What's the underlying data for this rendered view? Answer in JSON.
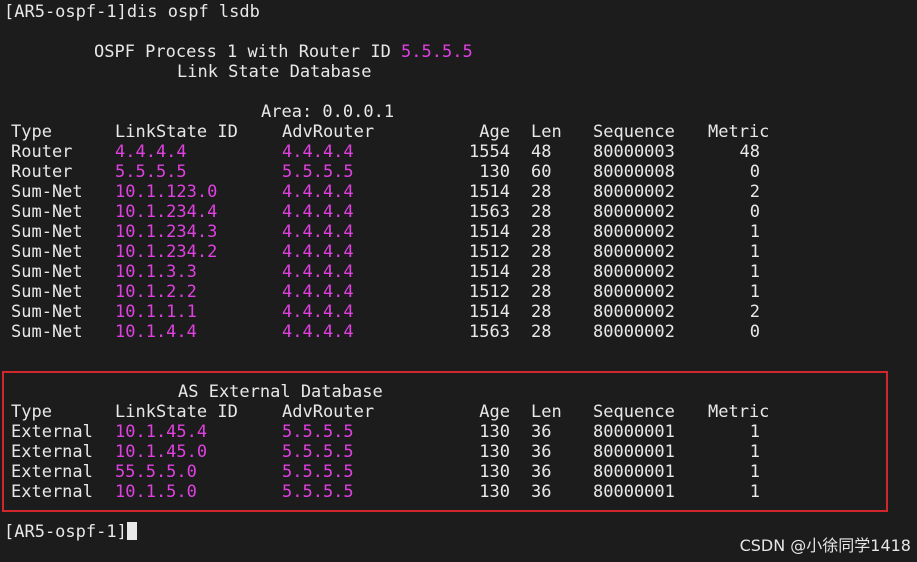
{
  "command_line": "[AR5-ospf-1]dis ospf lsdb",
  "header": {
    "process_prefix": "OSPF Process 1 with Router ID ",
    "router_id": "5.5.5.5",
    "db_title": "Link State Database",
    "area_label": "Area: 0.0.0.1"
  },
  "columns": {
    "type": "Type",
    "linkstate_id": "LinkState ID",
    "adv_router": "AdvRouter",
    "age": "Age",
    "len": "Len",
    "sequence": "Sequence",
    "metric": "Metric"
  },
  "area_rows": [
    {
      "type": "Router",
      "id": "4.4.4.4",
      "adv": "4.4.4.4",
      "age": "1554",
      "len": "48",
      "seq": "80000003",
      "metric": "48"
    },
    {
      "type": "Router",
      "id": "5.5.5.5",
      "adv": "5.5.5.5",
      "age": "130",
      "len": "60",
      "seq": "80000008",
      "metric": "0"
    },
    {
      "type": "Sum-Net",
      "id": "10.1.123.0",
      "adv": "4.4.4.4",
      "age": "1514",
      "len": "28",
      "seq": "80000002",
      "metric": "2"
    },
    {
      "type": "Sum-Net",
      "id": "10.1.234.4",
      "adv": "4.4.4.4",
      "age": "1563",
      "len": "28",
      "seq": "80000002",
      "metric": "0"
    },
    {
      "type": "Sum-Net",
      "id": "10.1.234.3",
      "adv": "4.4.4.4",
      "age": "1514",
      "len": "28",
      "seq": "80000002",
      "metric": "1"
    },
    {
      "type": "Sum-Net",
      "id": "10.1.234.2",
      "adv": "4.4.4.4",
      "age": "1512",
      "len": "28",
      "seq": "80000002",
      "metric": "1"
    },
    {
      "type": "Sum-Net",
      "id": "10.1.3.3",
      "adv": "4.4.4.4",
      "age": "1514",
      "len": "28",
      "seq": "80000002",
      "metric": "1"
    },
    {
      "type": "Sum-Net",
      "id": "10.1.2.2",
      "adv": "4.4.4.4",
      "age": "1512",
      "len": "28",
      "seq": "80000002",
      "metric": "1"
    },
    {
      "type": "Sum-Net",
      "id": "10.1.1.1",
      "adv": "4.4.4.4",
      "age": "1514",
      "len": "28",
      "seq": "80000002",
      "metric": "2"
    },
    {
      "type": "Sum-Net",
      "id": "10.1.4.4",
      "adv": "4.4.4.4",
      "age": "1563",
      "len": "28",
      "seq": "80000002",
      "metric": "0"
    }
  ],
  "external": {
    "title": "AS External Database",
    "rows": [
      {
        "type": "External",
        "id": "10.1.45.4",
        "adv": "5.5.5.5",
        "age": "130",
        "len": "36",
        "seq": "80000001",
        "metric": "1"
      },
      {
        "type": "External",
        "id": "10.1.45.0",
        "adv": "5.5.5.5",
        "age": "130",
        "len": "36",
        "seq": "80000001",
        "metric": "1"
      },
      {
        "type": "External",
        "id": "55.5.5.0",
        "adv": "5.5.5.5",
        "age": "130",
        "len": "36",
        "seq": "80000001",
        "metric": "1"
      },
      {
        "type": "External",
        "id": "10.1.5.0",
        "adv": "5.5.5.5",
        "age": "130",
        "len": "36",
        "seq": "80000001",
        "metric": "1"
      }
    ]
  },
  "prompt": "[AR5-ospf-1]",
  "watermark": "CSDN @小徐同学1418",
  "colors": {
    "background": "#1c1c1c",
    "text": "#e8e8e8",
    "magenta": "#e040e0",
    "highlight_border": "#d0262c"
  }
}
